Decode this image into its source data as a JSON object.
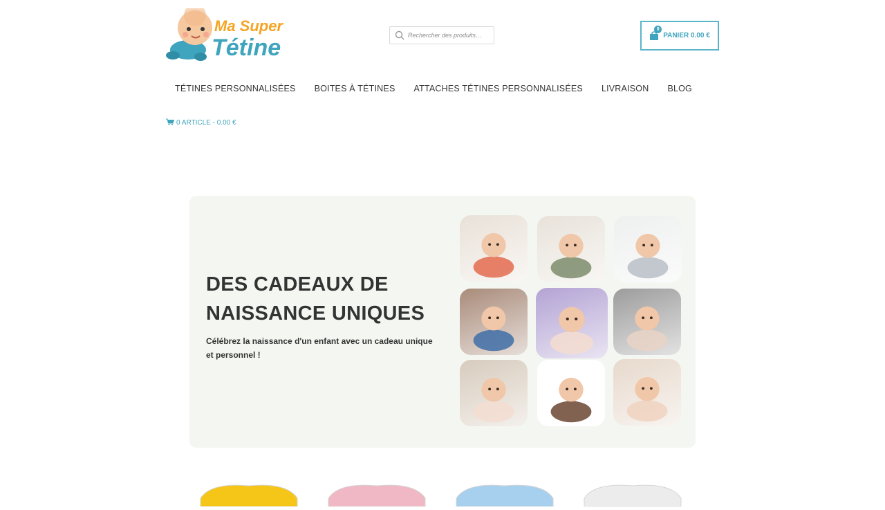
{
  "brand": {
    "logo_line1": "Ma Super",
    "logo_line2": "Tétine",
    "colors": {
      "orange": "#f4a524",
      "teal": "#3fa4bd",
      "skin": "#f6c89f"
    }
  },
  "search": {
    "placeholder": "Rechercher des produits…"
  },
  "header_cart": {
    "count": "0",
    "label": "PANIER 0.00 €"
  },
  "nav": {
    "items": [
      {
        "label": "TÉTINES PERSONNALISÉES"
      },
      {
        "label": "BOITES À TÉTINES"
      },
      {
        "label": "ATTACHES TÉTINES PERSONNALISÉES"
      },
      {
        "label": "LIVRAISON"
      },
      {
        "label": "BLOG"
      }
    ]
  },
  "mini_cart": {
    "label": "0 ARTICLE - 0.00 €"
  },
  "hero": {
    "title": "DES CADEAUX DE NAISSANCE UNIQUES",
    "subtitle": "Célébrez la naissance d'un enfant avec un cadeau unique et personnel !",
    "photos": [
      {
        "bg": "#e9e1d8",
        "accent": "#e36b4f"
      },
      {
        "bg": "#e8e2da",
        "accent": "#7d8c6c"
      },
      {
        "bg": "#eef0ef",
        "accent": "#b9bfc6"
      },
      {
        "bg": "#a98b7a",
        "accent": "#3f6fa8"
      },
      {
        "bg": "#b3a3d4",
        "accent": "#f4ddd0"
      },
      {
        "bg": "#9c9c9c",
        "accent": "#e8d3c4"
      },
      {
        "bg": "#d7cbbd",
        "accent": "#f3ddd0"
      },
      {
        "bg": "#ffffff",
        "accent": "#6b4530"
      },
      {
        "bg": "#e7d9cc",
        "accent": "#f0d2c0"
      }
    ]
  },
  "products": [
    {
      "color": "#f5c518"
    },
    {
      "color": "#f0b8c4"
    },
    {
      "color": "#a7d0ee"
    },
    {
      "color": "#ececec"
    }
  ]
}
